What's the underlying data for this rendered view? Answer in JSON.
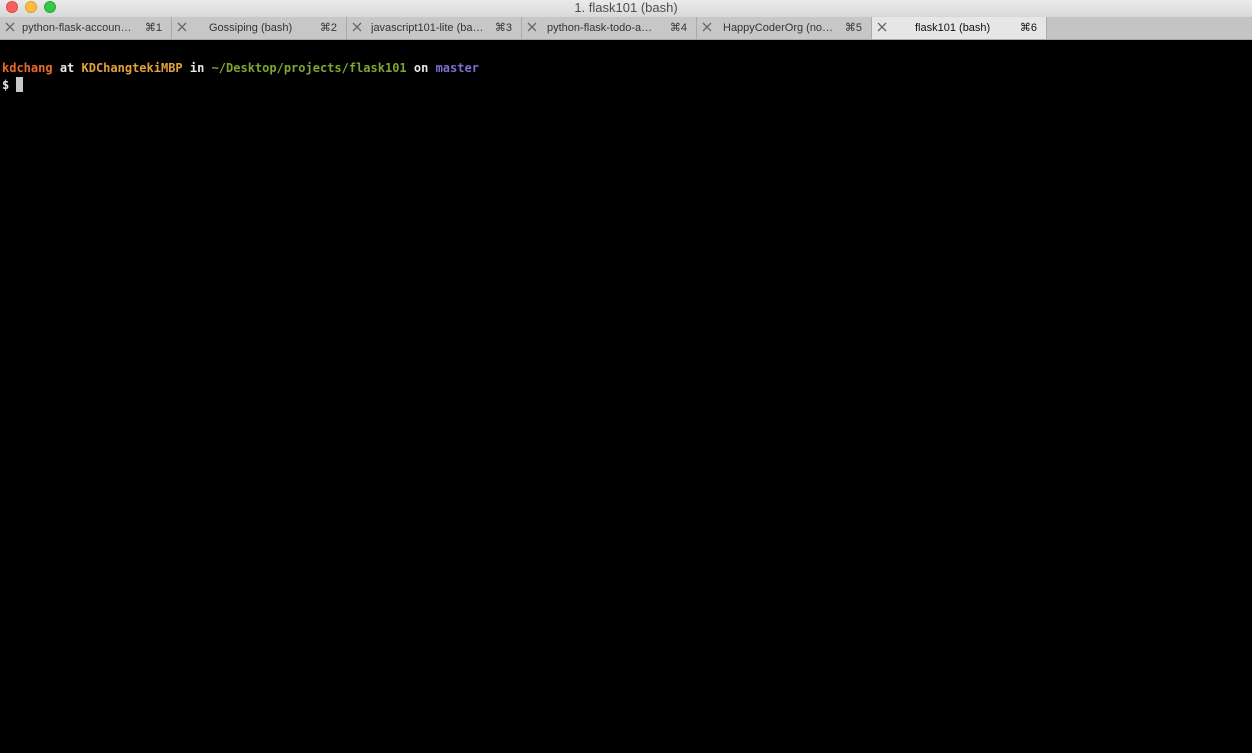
{
  "window": {
    "title": "1. flask101 (bash)"
  },
  "tabs": [
    {
      "label": "python-flask-accoun…",
      "shortcut": "⌘1",
      "active": false
    },
    {
      "label": "Gossiping (bash)",
      "shortcut": "⌘2",
      "active": false
    },
    {
      "label": "javascript101-lite (ba…",
      "shortcut": "⌘3",
      "active": false
    },
    {
      "label": "python-flask-todo-a…",
      "shortcut": "⌘4",
      "active": false
    },
    {
      "label": "HappyCoderOrg (no…",
      "shortcut": "⌘5",
      "active": false
    },
    {
      "label": "flask101 (bash)",
      "shortcut": "⌘6",
      "active": true
    }
  ],
  "prompt": {
    "user": "kdchang",
    "at": "at",
    "host": "KDChangtekiMBP",
    "in": "in",
    "path": "~/Desktop/projects/flask101",
    "on": "on",
    "branch": "master",
    "symbol": "$"
  },
  "colors": {
    "user": "#ea6a2a",
    "host": "#e0a23a",
    "path": "#7ea72e",
    "branch": "#7f6fd0",
    "plain": "#e8e8e8",
    "background": "#000000"
  }
}
